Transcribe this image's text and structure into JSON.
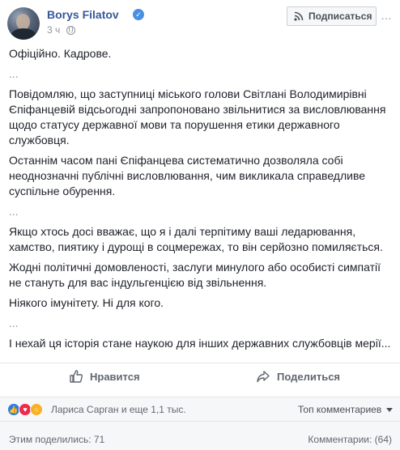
{
  "post": {
    "author": "Borys Filatov",
    "time": "3 ч",
    "follow_label": "Подписаться",
    "paragraphs": [
      "Офіційно. Кадрове.",
      "...",
      "Повідомляю, що заступниці міського голови Світлані Володимирівні Єпіфанцевій відсьогодні запропоновано звільнитися за висловлювання щодо статусу державної мови та порушення етики державного службовця.",
      "Останнім часом пані Єпіфанцева систематично дозволяла собі неоднозначні публічні висловлювання, чим викликала справедливе суспільне обурення.",
      "...",
      "Якщо хтось досі вважає, що я і далі терпітиму ваші ледарювання, хамство, пиятику і дурощі в соцмережах, то він серйозно помиляється.",
      "Жодні політичні домовленості, заслуги минулого або особисті симпатії не стануть для вас індульгенцією від звільнення.",
      "Ніякого імунітету. Ні для кого.",
      "...",
      "І нехай ця історія стане наукою для інших державних службовців мерії..."
    ]
  },
  "actions": {
    "like_label": "Нравится",
    "share_label": "Поделиться"
  },
  "reactions": {
    "icons": [
      "like-icon",
      "love-icon",
      "wow-icon"
    ],
    "summary": "Лариса Сарган и еще 1,1 тыс.",
    "sort_label": "Топ комментариев"
  },
  "counts": {
    "shares": "Этим поделились: 71",
    "comments": "Комментарии: (64)"
  },
  "colors": {
    "link_blue": "#365899",
    "verified_blue": "#4a90e2",
    "muted_grey": "#90949c",
    "like_blue": "#2d7be5",
    "love_red": "#f0284a",
    "wow_yellow": "#f7b125"
  }
}
